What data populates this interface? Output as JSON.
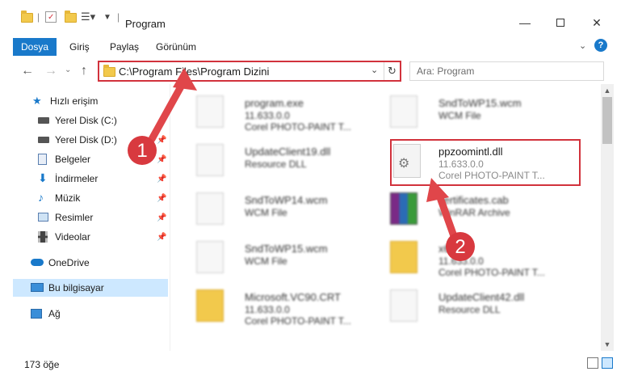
{
  "window": {
    "title": "Program",
    "colors": {
      "accent": "#1979ca",
      "highlight": "#d2323c",
      "selected": "#cde8ff"
    }
  },
  "ribbon": {
    "tabs": [
      {
        "label": "Dosya"
      },
      {
        "label": "Giriş"
      },
      {
        "label": "Paylaş"
      },
      {
        "label": "Görünüm"
      }
    ],
    "help": "?"
  },
  "address": {
    "path": "C:\\Program Files\\Program Dizini",
    "search_placeholder": "Ara: Program"
  },
  "nav": {
    "items": [
      {
        "label": "Hızlı erişim",
        "icon": "star-icon"
      },
      {
        "label": "Yerel Disk (C:)",
        "icon": "drive-icon"
      },
      {
        "label": "Yerel Disk (D:)",
        "icon": "drive-icon"
      },
      {
        "label": "Belgeler",
        "icon": "documents-icon"
      },
      {
        "label": "İndirmeler",
        "icon": "download-icon"
      },
      {
        "label": "Müzik",
        "icon": "music-icon"
      },
      {
        "label": "Resimler",
        "icon": "pictures-icon"
      },
      {
        "label": "Videolar",
        "icon": "video-icon"
      },
      {
        "label": "OneDrive",
        "icon": "cloud-icon"
      },
      {
        "label": "Bu bilgisayar",
        "icon": "computer-icon"
      },
      {
        "label": "Ağ",
        "icon": "network-icon"
      }
    ]
  },
  "files": [
    {
      "name": "program.exe",
      "line1": "11.633.0.0",
      "line2": "Corel PHOTO-PAINT T...",
      "icon": "exe-icon"
    },
    {
      "name": "SndToWP15.wcm",
      "line1": "WCM File",
      "line2": "",
      "icon": "file-icon"
    },
    {
      "name": "UpdateClient19.dll",
      "line1": "Resource DLL",
      "line2": "",
      "icon": "dll-icon"
    },
    {
      "name": "ppzoomintl.dll",
      "line1": "11.633.0.0",
      "line2": "Corel PHOTO-PAINT T...",
      "icon": "dll-icon"
    },
    {
      "name": "SndToWP14.wcm",
      "line1": "WCM File",
      "line2": "",
      "icon": "file-icon"
    },
    {
      "name": "certificates.cab",
      "line1": "WinRAR Archive",
      "line2": "",
      "icon": "archive-icon"
    },
    {
      "name": "SndToWP15.wcm",
      "line1": "WCM File",
      "line2": "",
      "icon": "file-icon"
    },
    {
      "name": "x64",
      "line1": "11.633.0.0",
      "line2": "Corel PHOTO-PAINT T...",
      "icon": "folder-icon"
    },
    {
      "name": "Microsoft.VC90.CRT",
      "line1": "11.633.0.0",
      "line2": "Corel PHOTO-PAINT T...",
      "icon": "folder-icon"
    },
    {
      "name": "UpdateClient42.dll",
      "line1": "Resource DLL",
      "line2": "",
      "icon": "dll-icon"
    }
  ],
  "annotations": [
    {
      "label": "1"
    },
    {
      "label": "2"
    }
  ],
  "status": {
    "count": "173 öğe"
  }
}
